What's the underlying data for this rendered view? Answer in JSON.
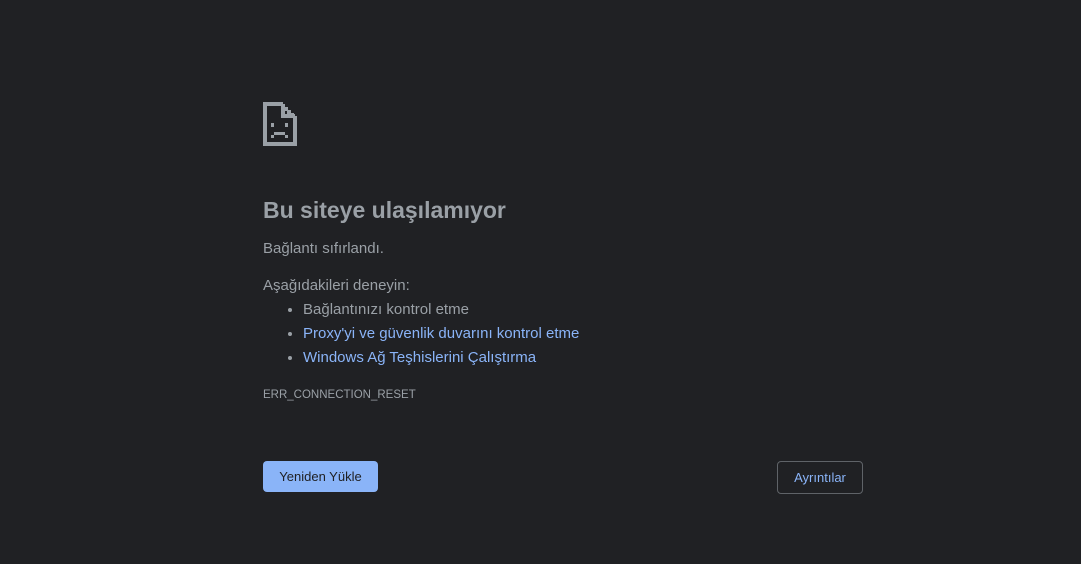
{
  "error": {
    "icon": "sad-page-icon",
    "title": "Bu siteye ulaşılamıyor",
    "summary": "Bağlantı sıfırlandı.",
    "suggestions_heading": "Aşağıdakileri deneyin:",
    "suggestions": [
      {
        "label": "Bağlantınızı kontrol etme",
        "is_link": false
      },
      {
        "label": "Proxy'yi ve güvenlik duvarını kontrol etme",
        "is_link": true
      },
      {
        "label": "Windows Ağ Teşhislerini Çalıştırma",
        "is_link": true
      }
    ],
    "code": "ERR_CONNECTION_RESET"
  },
  "buttons": {
    "reload_label": "Yeniden Yükle",
    "details_label": "Ayrıntılar"
  },
  "colors": {
    "background": "#202124",
    "text": "#9aa0a6",
    "link": "#8ab4f8",
    "primary_button_bg": "#8ab4f8",
    "secondary_button_border": "#5f6368"
  }
}
